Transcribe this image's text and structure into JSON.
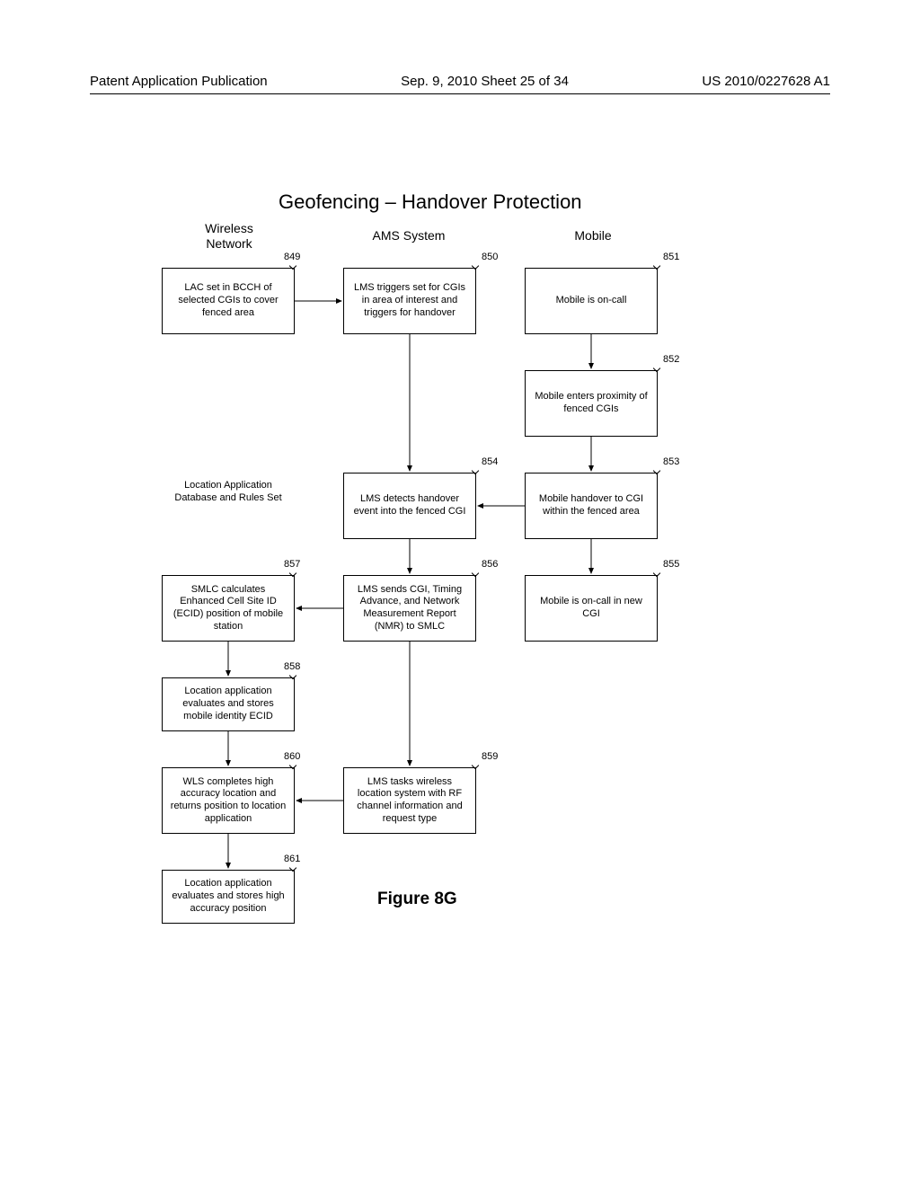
{
  "header": {
    "left": "Patent Application Publication",
    "center": "Sep. 9, 2010  Sheet 25 of 34",
    "right": "US 2010/0227628 A1"
  },
  "title": "Geofencing – Handover Protection",
  "columns": {
    "wireless": "Wireless\nNetwork",
    "ams": "AMS System",
    "mobile": "Mobile"
  },
  "boxes": {
    "b849": "LAC set in BCCH of selected CGIs to cover fenced area",
    "b850": "LMS triggers set for CGIs in area of interest and triggers for handover",
    "b851": "Mobile is on-call",
    "b852": "Mobile enters proximity of fenced CGIs",
    "b853": "Mobile handover to CGI within the fenced area",
    "b854": "LMS detects handover event into the fenced CGI",
    "b855": "Mobile is on-call in new CGI",
    "b856": "LMS sends CGI, Timing Advance, and Network Measurement Report (NMR) to SMLC",
    "b857": "SMLC calculates Enhanced Cell Site ID (ECID) position of mobile station",
    "bLocApp": "Location Application Database and Rules Set",
    "b858": "Location application evaluates and stores mobile identity ECID",
    "b859": "LMS tasks wireless location system with RF channel information and request type",
    "b860": "WLS completes high accuracy location and returns position to location application",
    "b861": "Location application evaluates and stores high accuracy position"
  },
  "refs": {
    "r849": "849",
    "r850": "850",
    "r851": "851",
    "r852": "852",
    "r853": "853",
    "r854": "854",
    "r855": "855",
    "r856": "856",
    "r857": "857",
    "r858": "858",
    "r859": "859",
    "r860": "860",
    "r861": "861"
  },
  "figure": "Figure 8G"
}
